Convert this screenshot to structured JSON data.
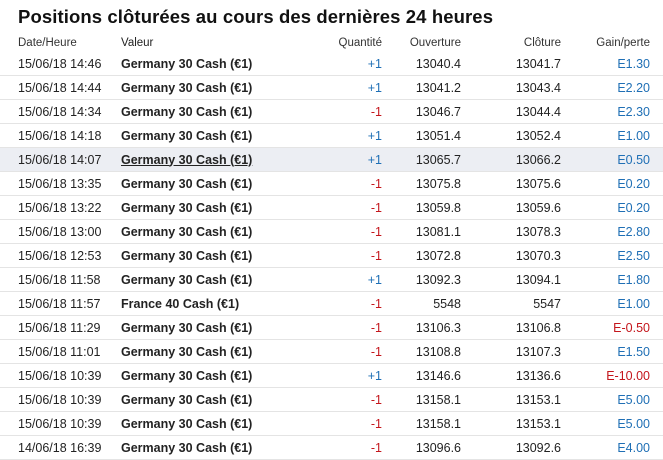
{
  "title": "Positions clôturées au cours des dernières 24 heures",
  "columns": {
    "date": "Date/Heure",
    "symbol": "Valeur",
    "quantity": "Quantité",
    "open": "Ouverture",
    "close": "Clôture",
    "pl": "Gain/perte"
  },
  "rows": [
    {
      "date": "15/06/18 14:46",
      "symbol": "Germany 30 Cash (€1)",
      "quantity": "+1",
      "open": "13040.4",
      "close": "13041.7",
      "pl": "E1.30"
    },
    {
      "date": "15/06/18 14:44",
      "symbol": "Germany 30 Cash (€1)",
      "quantity": "+1",
      "open": "13041.2",
      "close": "13043.4",
      "pl": "E2.20"
    },
    {
      "date": "15/06/18 14:34",
      "symbol": "Germany 30 Cash (€1)",
      "quantity": "-1",
      "open": "13046.7",
      "close": "13044.4",
      "pl": "E2.30"
    },
    {
      "date": "15/06/18 14:18",
      "symbol": "Germany 30 Cash (€1)",
      "quantity": "+1",
      "open": "13051.4",
      "close": "13052.4",
      "pl": "E1.00"
    },
    {
      "date": "15/06/18 14:07",
      "symbol": "Germany 30 Cash (€1)",
      "quantity": "+1",
      "open": "13065.7",
      "close": "13066.2",
      "pl": "E0.50",
      "highlighted": true
    },
    {
      "date": "15/06/18 13:35",
      "symbol": "Germany 30 Cash (€1)",
      "quantity": "-1",
      "open": "13075.8",
      "close": "13075.6",
      "pl": "E0.20"
    },
    {
      "date": "15/06/18 13:22",
      "symbol": "Germany 30 Cash (€1)",
      "quantity": "-1",
      "open": "13059.8",
      "close": "13059.6",
      "pl": "E0.20"
    },
    {
      "date": "15/06/18 13:00",
      "symbol": "Germany 30 Cash (€1)",
      "quantity": "-1",
      "open": "13081.1",
      "close": "13078.3",
      "pl": "E2.80"
    },
    {
      "date": "15/06/18 12:53",
      "symbol": "Germany 30 Cash (€1)",
      "quantity": "-1",
      "open": "13072.8",
      "close": "13070.3",
      "pl": "E2.50"
    },
    {
      "date": "15/06/18 11:58",
      "symbol": "Germany 30 Cash (€1)",
      "quantity": "+1",
      "open": "13092.3",
      "close": "13094.1",
      "pl": "E1.80"
    },
    {
      "date": "15/06/18 11:57",
      "symbol": "France 40 Cash (€1)",
      "quantity": "-1",
      "open": "5548",
      "close": "5547",
      "pl": "E1.00"
    },
    {
      "date": "15/06/18 11:29",
      "symbol": "Germany 30 Cash (€1)",
      "quantity": "-1",
      "open": "13106.3",
      "close": "13106.8",
      "pl": "E-0.50"
    },
    {
      "date": "15/06/18 11:01",
      "symbol": "Germany 30 Cash (€1)",
      "quantity": "-1",
      "open": "13108.8",
      "close": "13107.3",
      "pl": "E1.50"
    },
    {
      "date": "15/06/18 10:39",
      "symbol": "Germany 30 Cash (€1)",
      "quantity": "+1",
      "open": "13146.6",
      "close": "13136.6",
      "pl": "E-10.00"
    },
    {
      "date": "15/06/18 10:39",
      "symbol": "Germany 30 Cash (€1)",
      "quantity": "-1",
      "open": "13158.1",
      "close": "13153.1",
      "pl": "E5.00"
    },
    {
      "date": "15/06/18 10:39",
      "symbol": "Germany 30 Cash (€1)",
      "quantity": "-1",
      "open": "13158.1",
      "close": "13153.1",
      "pl": "E5.00"
    },
    {
      "date": "14/06/18 16:39",
      "symbol": "Germany 30 Cash (€1)",
      "quantity": "-1",
      "open": "13096.6",
      "close": "13092.6",
      "pl": "E4.00"
    }
  ],
  "colors": {
    "positive": "#1f6fb5",
    "negative": "#c4161c",
    "highlight_row": "#eceef3"
  }
}
